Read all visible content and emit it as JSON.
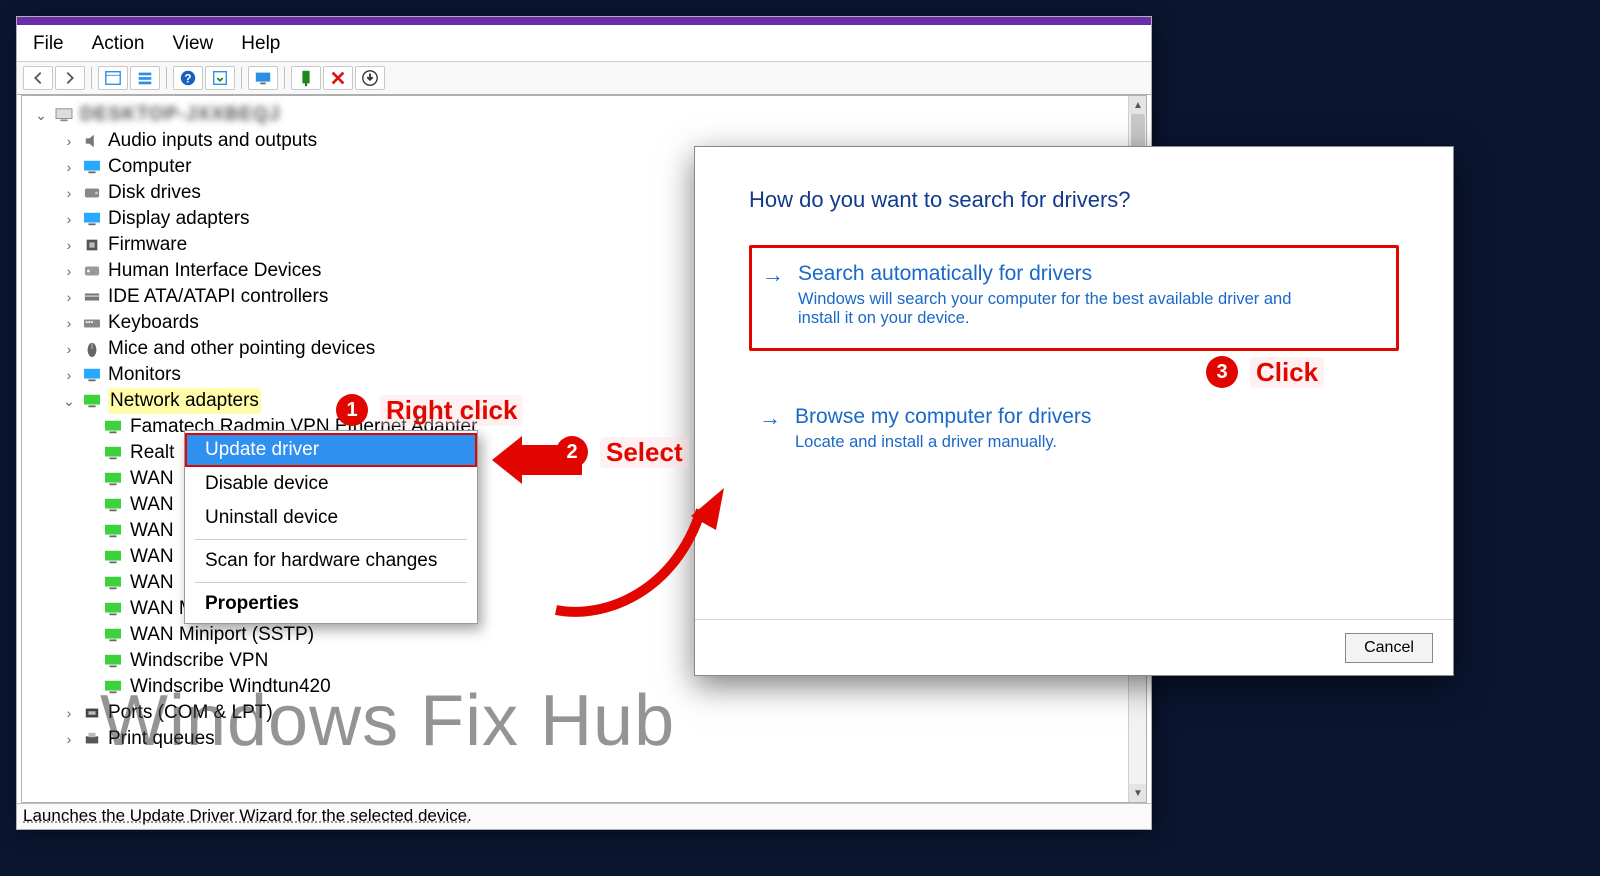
{
  "menubar": [
    "File",
    "Action",
    "View",
    "Help"
  ],
  "toolbar": [
    "back",
    "forward",
    "details",
    "list",
    "help",
    "refresh",
    "monitor",
    "scan",
    "delete",
    "down"
  ],
  "root_node": "DESKTOP-JXXBEQJ",
  "categories": [
    {
      "label": "Audio inputs and outputs",
      "icon": "speaker"
    },
    {
      "label": "Computer",
      "icon": "monitor",
      "color": "blue"
    },
    {
      "label": "Disk drives",
      "icon": "disk"
    },
    {
      "label": "Display adapters",
      "icon": "monitor",
      "color": "blue"
    },
    {
      "label": "Firmware",
      "icon": "chip"
    },
    {
      "label": "Human Interface Devices",
      "icon": "hid"
    },
    {
      "label": "IDE ATA/ATAPI controllers",
      "icon": "card"
    },
    {
      "label": "Keyboards",
      "icon": "keyboard"
    },
    {
      "label": "Mice and other pointing devices",
      "icon": "mouse"
    },
    {
      "label": "Monitors",
      "icon": "monitor",
      "color": "blue"
    },
    {
      "label": "Network adapters",
      "icon": "monitor",
      "color": "green",
      "expanded": true,
      "highlight": true
    },
    {
      "label": "Ports (COM & LPT)",
      "icon": "port"
    },
    {
      "label": "Print queues",
      "icon": "printer"
    }
  ],
  "network_children": [
    "Famatech Radmin VPN Ethernet Adapter",
    "Realt",
    "WAN",
    "WAN",
    "WAN",
    "WAN",
    "WAN",
    "WAN Miniport (PPTP)",
    "WAN Miniport (SSTP)",
    "Windscribe VPN",
    "Windscribe Windtun420"
  ],
  "context_menu": [
    {
      "label": "Update driver",
      "selected": true
    },
    {
      "label": "Disable device"
    },
    {
      "label": "Uninstall device"
    },
    {
      "sep": true
    },
    {
      "label": "Scan for hardware changes"
    },
    {
      "sep": true
    },
    {
      "label": "Properties",
      "bold": true
    }
  ],
  "dialog": {
    "heading": "How do you want to search for drivers?",
    "option1_title": "Search automatically for drivers",
    "option1_desc": "Windows will search your computer for the best available driver and install it on your device.",
    "option2_title": "Browse my computer for drivers",
    "option2_desc": "Locate and install a driver manually.",
    "cancel": "Cancel"
  },
  "annotations": {
    "a1": "Right click",
    "a2": "Select",
    "a3": "Click"
  },
  "statusbar": "Launches the Update Driver Wizard for the selected device.",
  "watermark": "Windows Fix Hub"
}
